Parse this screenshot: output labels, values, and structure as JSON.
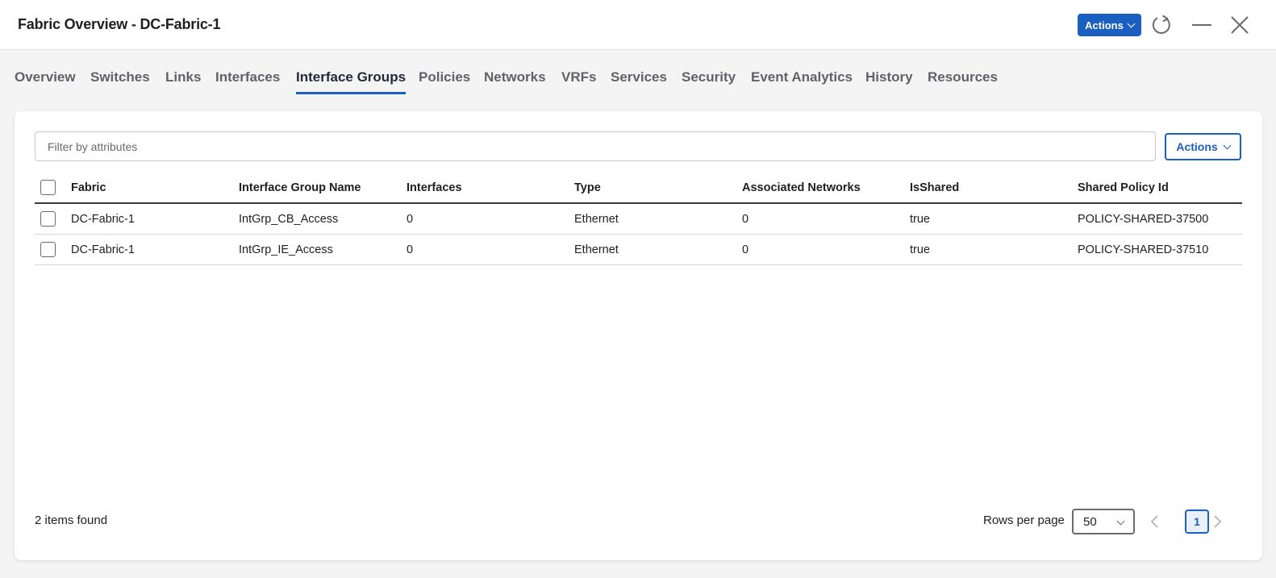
{
  "window": {
    "title": "Fabric Overview - DC-Fabric-1",
    "actions_label": "Actions"
  },
  "tabs": [
    {
      "label": "Overview"
    },
    {
      "label": "Switches"
    },
    {
      "label": "Links"
    },
    {
      "label": "Interfaces"
    },
    {
      "label": "Interface Groups",
      "active": true
    },
    {
      "label": "Policies"
    },
    {
      "label": "Networks"
    },
    {
      "label": "VRFs"
    },
    {
      "label": "Services"
    },
    {
      "label": "Security"
    },
    {
      "label": "Event Analytics"
    },
    {
      "label": "History"
    },
    {
      "label": "Resources"
    }
  ],
  "toolbar": {
    "filter_placeholder": "Filter by attributes",
    "actions_label": "Actions"
  },
  "table": {
    "columns": [
      "Fabric",
      "Interface Group Name",
      "Interfaces",
      "Type",
      "Associated Networks",
      "IsShared",
      "Shared Policy Id"
    ],
    "rows": [
      [
        "DC-Fabric-1",
        "IntGrp_CB_Access",
        "0",
        "Ethernet",
        "0",
        "true",
        "POLICY-SHARED-37500"
      ],
      [
        "DC-Fabric-1",
        "IntGrp_IE_Access",
        "0",
        "Ethernet",
        "0",
        "true",
        "POLICY-SHARED-37510"
      ]
    ]
  },
  "footer": {
    "items_found": "2 items found",
    "rows_per_page_label": "Rows per page",
    "rows_per_page_value": "50",
    "current_page": "1"
  },
  "colors": {
    "accent": "#1b5fc1",
    "background": "#f4f4f4",
    "card": "#ffffff"
  },
  "icons": [
    "chevron-down-icon",
    "refresh-icon",
    "minimize-icon",
    "close-icon",
    "chevron-left-icon",
    "chevron-right-icon"
  ]
}
